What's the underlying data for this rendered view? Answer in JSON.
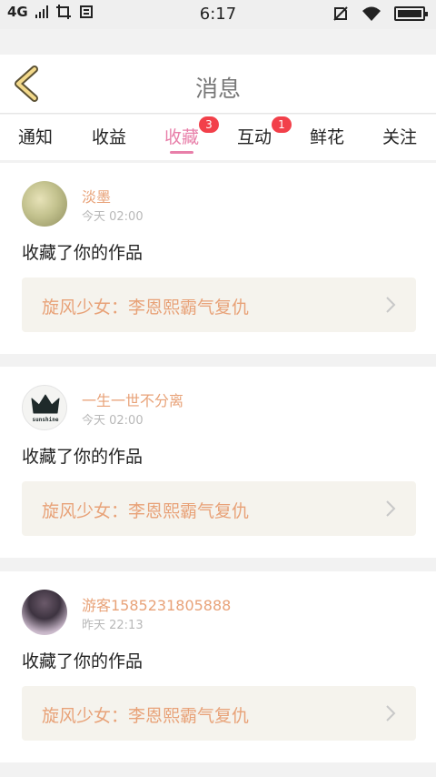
{
  "status_bar": {
    "network": "4G",
    "time": "6:17"
  },
  "header": {
    "title": "消息"
  },
  "tabs": [
    {
      "label": "通知"
    },
    {
      "label": "收益"
    },
    {
      "label": "收藏",
      "badge": "3"
    },
    {
      "label": "互动",
      "badge": "1"
    },
    {
      "label": "鲜花"
    },
    {
      "label": "关注"
    }
  ],
  "messages": [
    {
      "user": "淡墨",
      "time": "今天 02:00",
      "text": "收藏了你的作品",
      "work_title": "旋风少女：李恩熙霸气复仇"
    },
    {
      "user": "一生一世不分离",
      "time": "今天 02:00",
      "text": "收藏了你的作品",
      "work_title": "旋风少女：李恩熙霸气复仇",
      "avatar_text": "sunshine"
    },
    {
      "user": "游客1585231805888",
      "time": "昨天 22:13",
      "text": "收藏了你的作品",
      "work_title": "旋风少女：李恩熙霸气复仇"
    }
  ],
  "colors": {
    "accent_pink": "#e87fa9",
    "orange_text": "#e8a278",
    "badge_red": "#f2404a",
    "work_bg": "#f5f3ed"
  }
}
